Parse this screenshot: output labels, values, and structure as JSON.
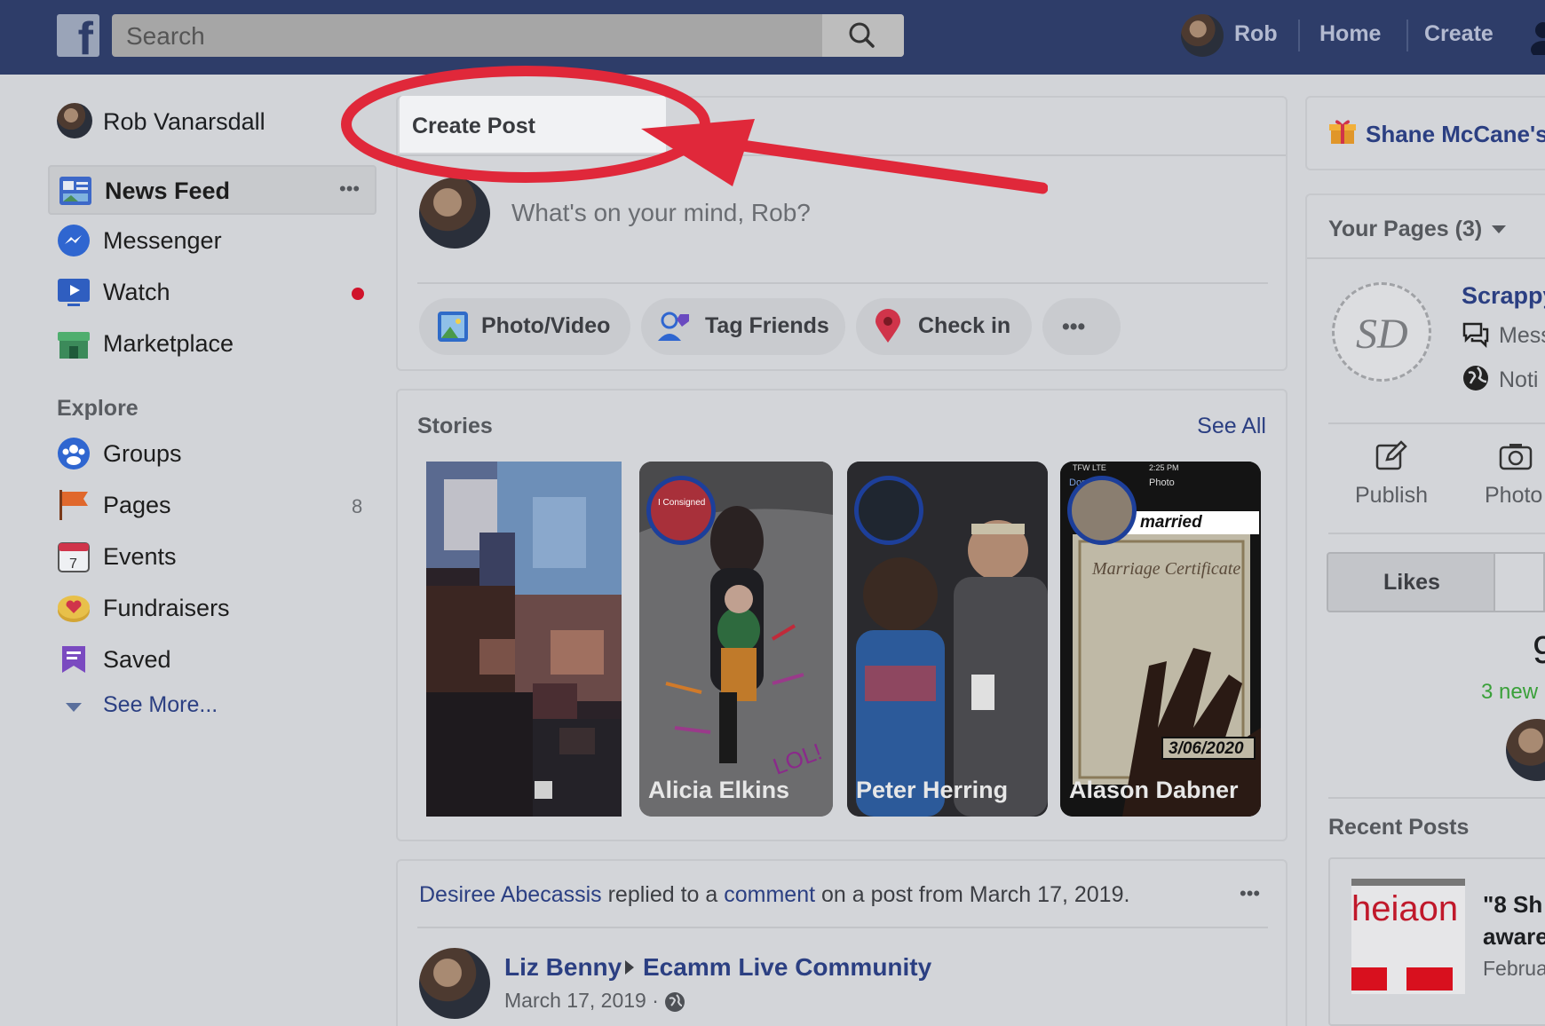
{
  "topbar": {
    "logo_glyph": "f",
    "search_placeholder": "Search",
    "user_name": "Rob",
    "nav_home": "Home",
    "nav_create": "Create"
  },
  "sidebar": {
    "profile_name": "Rob Vanarsdall",
    "items": [
      {
        "label": "News Feed",
        "icon": "news-feed-icon"
      },
      {
        "label": "Messenger",
        "icon": "messenger-icon"
      },
      {
        "label": "Watch",
        "icon": "watch-icon"
      },
      {
        "label": "Marketplace",
        "icon": "marketplace-icon"
      }
    ],
    "more_glyph": "•••",
    "explore_heading": "Explore",
    "explore_items": [
      {
        "label": "Groups",
        "icon": "groups-icon",
        "count": ""
      },
      {
        "label": "Pages",
        "icon": "pages-flag-icon",
        "count": "8"
      },
      {
        "label": "Events",
        "icon": "events-calendar-icon",
        "count": ""
      },
      {
        "label": "Fundraisers",
        "icon": "fundraisers-icon",
        "count": ""
      },
      {
        "label": "Saved",
        "icon": "saved-icon",
        "count": ""
      }
    ],
    "see_more": "See More..."
  },
  "composer": {
    "tab_label": "Create Post",
    "placeholder": "What's on your mind, Rob?",
    "actions": [
      {
        "label": "Photo/Video",
        "icon": "photo-video-icon"
      },
      {
        "label": "Tag Friends",
        "icon": "tag-friends-icon"
      },
      {
        "label": "Check in",
        "icon": "check-in-pin-icon"
      }
    ],
    "more_glyph": "•••"
  },
  "stories": {
    "heading": "Stories",
    "see_all": "See All",
    "items": [
      {
        "name": ""
      },
      {
        "name": "Alicia Elkins",
        "overlay": "LOL!",
        "ring_text": "I Consigned"
      },
      {
        "name": "Peter Herring"
      },
      {
        "name": "Alason Dabner",
        "overlay": "married",
        "date": "3/06/2020",
        "title_text": "Marriage Certificate",
        "phone_status": "TFW LTE",
        "phone_time": "2:25 PM",
        "phone_done": "Done",
        "phone_title": "Photo"
      }
    ]
  },
  "post": {
    "actor": "Desiree Abecassis",
    "text_a": " replied to a ",
    "text_link": "comment",
    "text_b": " on a post from March 17, 2019.",
    "more_glyph": "•••",
    "author": "Liz Benny",
    "group": "Ecamm Live Community",
    "date": "March 17, 2019 ·"
  },
  "right": {
    "birthday_text": "Shane McCane's",
    "your_pages": "Your Pages (3)",
    "page_name": "Scrappy",
    "page_logo_text": "SD",
    "page_row1": "Mess",
    "page_row2": "Noti",
    "publish": "Publish",
    "photo": "Photo",
    "likes_tab": "Likes",
    "big_number": "9",
    "new_count": "3 new",
    "recent_posts": "Recent Posts",
    "recent_thumb": "heiaon",
    "recent_title_1": "\"8 Sh",
    "recent_title_2": "aware",
    "recent_date": "Februa"
  },
  "colors": {
    "topbar": "#2e3d69",
    "annotation_red": "#e0283a",
    "link_blue": "#2b3f82",
    "notification_dot": "#d0132b",
    "new_green": "#3aa03a"
  }
}
